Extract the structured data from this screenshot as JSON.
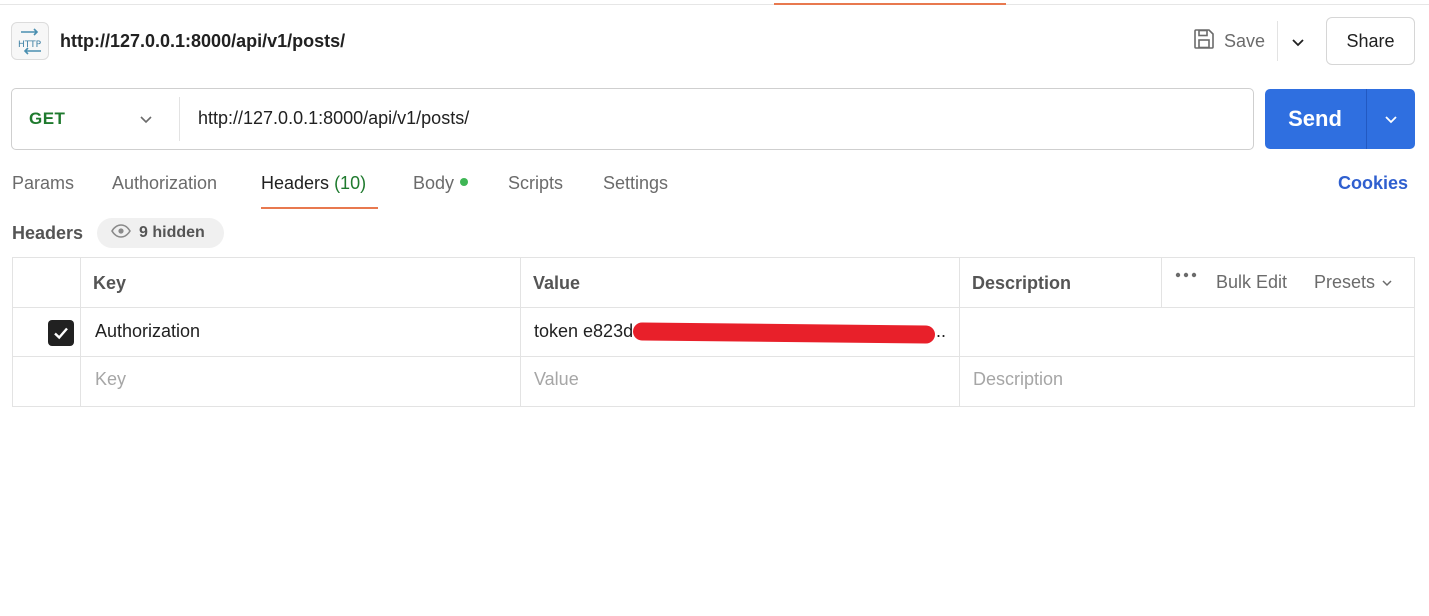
{
  "request": {
    "title": "http://127.0.0.1:8000/api/v1/posts/",
    "method": "GET",
    "url": "http://127.0.0.1:8000/api/v1/posts/"
  },
  "toolbar": {
    "save_label": "Save",
    "share_label": "Share",
    "send_label": "Send"
  },
  "tabs": [
    {
      "label": "Params"
    },
    {
      "label": "Authorization"
    },
    {
      "label": "Headers",
      "count": "(10)"
    },
    {
      "label": "Body"
    },
    {
      "label": "Scripts"
    },
    {
      "label": "Settings"
    }
  ],
  "active_tab": "Headers",
  "cookies_label": "Cookies",
  "headers_section": {
    "title": "Headers",
    "hidden_label": "9 hidden"
  },
  "table": {
    "columns": {
      "key": "Key",
      "value": "Value",
      "description": "Description"
    },
    "bulk_edit": "Bulk Edit",
    "presets": "Presets",
    "rows": [
      {
        "checked": true,
        "key": "Authorization",
        "value": "token e823d",
        "value_suffix": "..",
        "description": ""
      }
    ],
    "placeholders": {
      "key": "Key",
      "value": "Value",
      "description": "Description"
    }
  },
  "colors": {
    "accent_orange": "#e8794f",
    "send_blue": "#2f6fe0",
    "method_green": "#1f7a2e",
    "cookies_blue": "#2f5fcf",
    "body_dot": "#3fb655",
    "redaction_red": "#e8202a"
  },
  "icons": [
    "http-icon",
    "save-icon",
    "chevron-down-icon",
    "eye-icon",
    "more-icon",
    "check-icon"
  ]
}
